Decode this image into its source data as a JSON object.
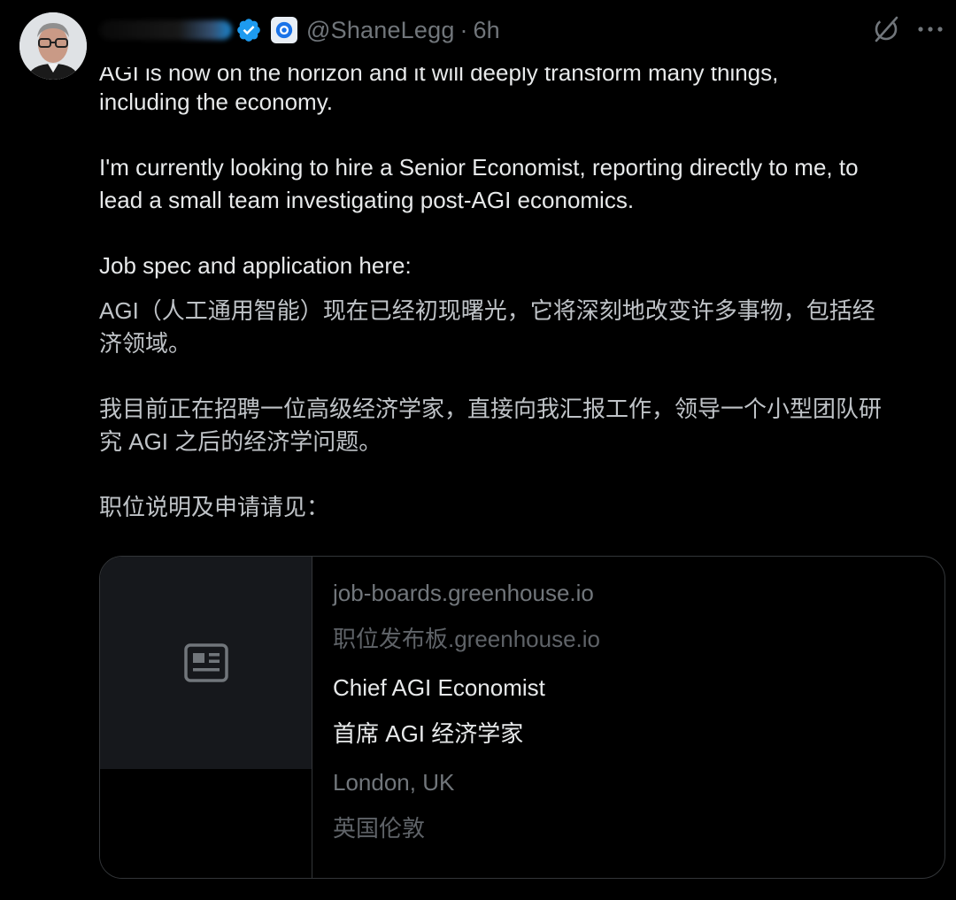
{
  "tweet": {
    "handle": "@ShaneLegg",
    "separator": "·",
    "time": "6h",
    "icons": {
      "verified": "verified-badge-icon",
      "affiliation": "affiliation-badge-icon",
      "grok": "grok-icon",
      "more": "more-options-icon"
    },
    "colors": {
      "verified": "#1d9bf0",
      "background": "#000000",
      "text": "#e7e9ea",
      "muted": "#71767b"
    },
    "body": {
      "cut_line": "AGI is now on the horizon and it will deeply transform many things,",
      "line2": "including the economy.",
      "para2_line1": "I'm currently looking to hire a Senior Economist, reporting directly to me, to",
      "para2_line2": "lead a small team investigating post-AGI economics.",
      "para3": "Job spec and application here:"
    },
    "translation": {
      "line1": "AGI（人工通用智能）现在已经初现曙光，它将深刻地改变许多事物，包括经",
      "line2": "济领域。",
      "line3": "我目前正在招聘一位高级经济学家，直接向我汇报工作，领导一个小型团队研",
      "line4": "究 AGI 之后的经济学问题。",
      "line5": "职位说明及申请请见："
    },
    "card": {
      "thumbnail_icon": "article-icon",
      "domain": "job-boards.greenhouse.io",
      "domain_zh": "职位发布板.greenhouse.io",
      "title": "Chief AGI Economist",
      "title_zh": "首席 AGI 经济学家",
      "location": "London, UK",
      "location_zh": "英国伦敦"
    }
  }
}
